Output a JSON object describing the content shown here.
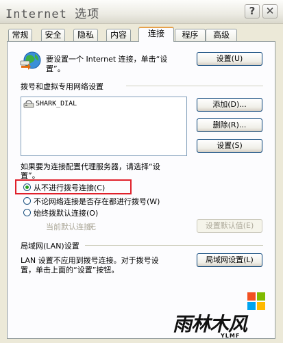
{
  "window": {
    "title": "Internet 选项",
    "help_label": "?",
    "close_label": "✕"
  },
  "tabs": [
    {
      "label": "常规"
    },
    {
      "label": "安全"
    },
    {
      "label": "隐私"
    },
    {
      "label": "内容"
    },
    {
      "label": "连接"
    },
    {
      "label": "程序"
    },
    {
      "label": "高级"
    }
  ],
  "active_tab": "连接",
  "setup": {
    "text_line1": "要设置一个 Internet 连接，单击“设",
    "text_line2": "置”。",
    "button": "设置(U)"
  },
  "dialup": {
    "group_label": "拨号和虚拟专用网络设置",
    "items": [
      "SHARK_DIAL"
    ],
    "add_button": "添加(D)...",
    "remove_button": "删除(R)...",
    "settings_button": "设置(S)",
    "proxy_text_line1": "如果要为连接配置代理服务器，请选择“设",
    "proxy_text_line2": "置”。",
    "options": [
      {
        "label": "从不进行拨号连接(C)",
        "checked": true
      },
      {
        "label": "不论网络连接是否存在都进行拨号(W)",
        "checked": false
      },
      {
        "label": "始终拨默认连接(O)",
        "checked": false
      }
    ],
    "current_default_label": "当前默认连接:",
    "current_default_value": "无",
    "set_default_button": "设置默认值(E)"
  },
  "lan": {
    "group_label": "局域网(LAN)设置",
    "text_line1": "LAN 设置不应用到拨号连接。对于拨号设",
    "text_line2": "置，单击上面的“设置”按钮。",
    "button": "局域网设置(L)"
  },
  "watermark": {
    "text": "雨林木风",
    "subtext": "YLMF"
  },
  "colors": {
    "highlight_box": "#e0202a",
    "active_tab_accent": "#e6a24c",
    "button_border": "#003c74"
  }
}
